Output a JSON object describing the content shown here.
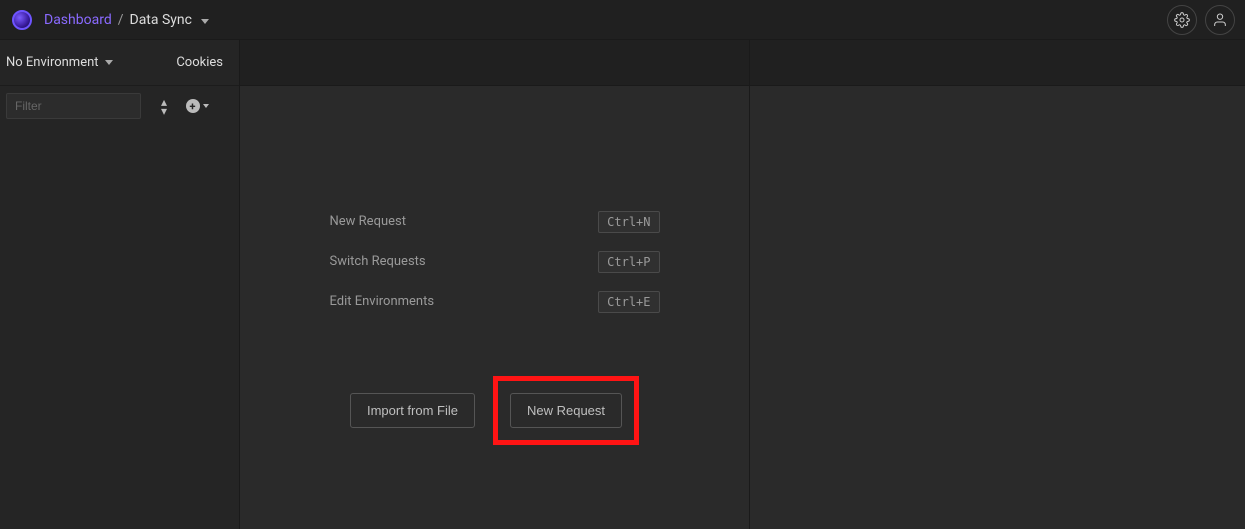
{
  "header": {
    "breadcrumb_root": "Dashboard",
    "breadcrumb_separator": "/",
    "breadcrumb_current": "Data Sync"
  },
  "sidebar": {
    "environment_label": "No Environment",
    "cookies_label": "Cookies",
    "filter_placeholder": "Filter"
  },
  "center": {
    "shortcuts": [
      {
        "label": "New Request",
        "keys": "Ctrl+N"
      },
      {
        "label": "Switch Requests",
        "keys": "Ctrl+P"
      },
      {
        "label": "Edit Environments",
        "keys": "Ctrl+E"
      }
    ],
    "import_button": "Import from File",
    "new_request_button": "New Request"
  }
}
